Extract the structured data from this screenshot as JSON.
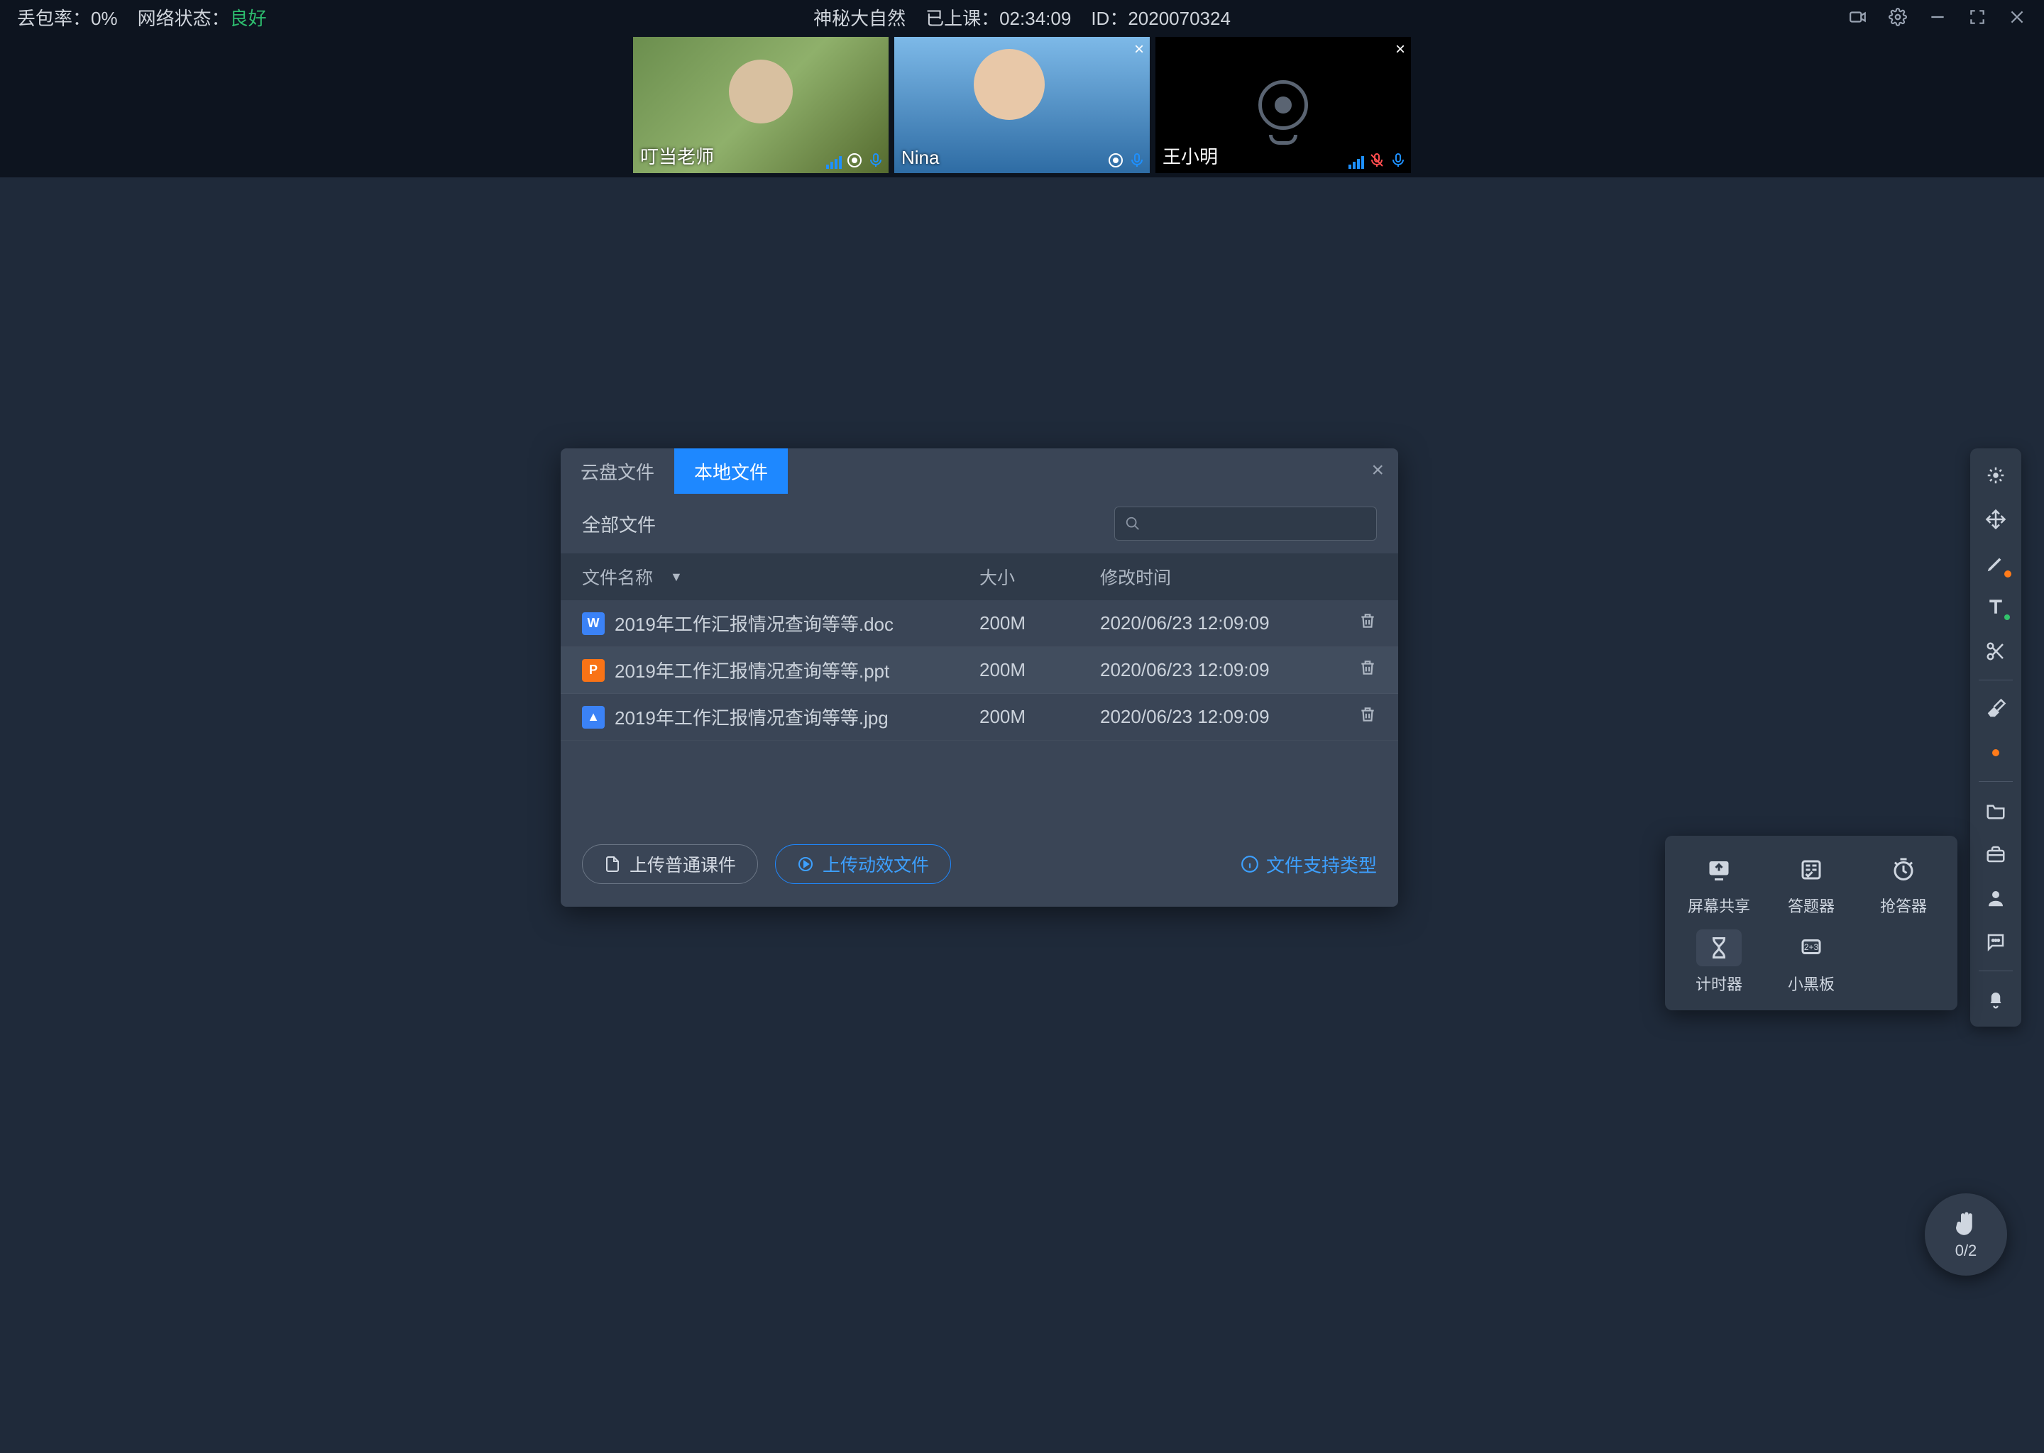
{
  "topbar": {
    "packet_loss_label": "丢包率：",
    "packet_loss_value": "0%",
    "net_label": "网络状态：",
    "net_value": "良好",
    "title": "神秘大自然",
    "elapsed_label": "已上课：",
    "elapsed_value": "02:34:09",
    "id_label": "ID：",
    "id_value": "2020070324"
  },
  "videos": [
    {
      "name": "叮当老师",
      "closable": false,
      "mic_muted": false,
      "has_cam": true
    },
    {
      "name": "Nina",
      "closable": true,
      "mic_muted": false,
      "has_cam": true
    },
    {
      "name": "王小明",
      "closable": true,
      "mic_muted": true,
      "has_cam": false
    }
  ],
  "dialog": {
    "tabs": {
      "cloud": "云盘文件",
      "local": "本地文件"
    },
    "close": "×",
    "all_files": "全部文件",
    "columns": {
      "name": "文件名称",
      "size": "大小",
      "date": "修改时间"
    },
    "files": [
      {
        "icon": "W",
        "icon_cls": "ico-doc",
        "name": "2019年工作汇报情况查询等等.doc",
        "size": "200M",
        "date": "2020/06/23 12:09:09"
      },
      {
        "icon": "P",
        "icon_cls": "ico-ppt",
        "name": "2019年工作汇报情况查询等等.ppt",
        "size": "200M",
        "date": "2020/06/23 12:09:09"
      },
      {
        "icon": "▲",
        "icon_cls": "ico-jpg",
        "name": "2019年工作汇报情况查询等等.jpg",
        "size": "200M",
        "date": "2020/06/23 12:09:09"
      }
    ],
    "btn_normal": "上传普通课件",
    "btn_anim": "上传动效文件",
    "support_link": "文件支持类型"
  },
  "tools_popup": {
    "screen_share": "屏幕共享",
    "answer": "答题器",
    "buzzer": "抢答器",
    "timer": "计时器",
    "blackboard": "小黑板"
  },
  "hand": {
    "count": "0/2"
  }
}
